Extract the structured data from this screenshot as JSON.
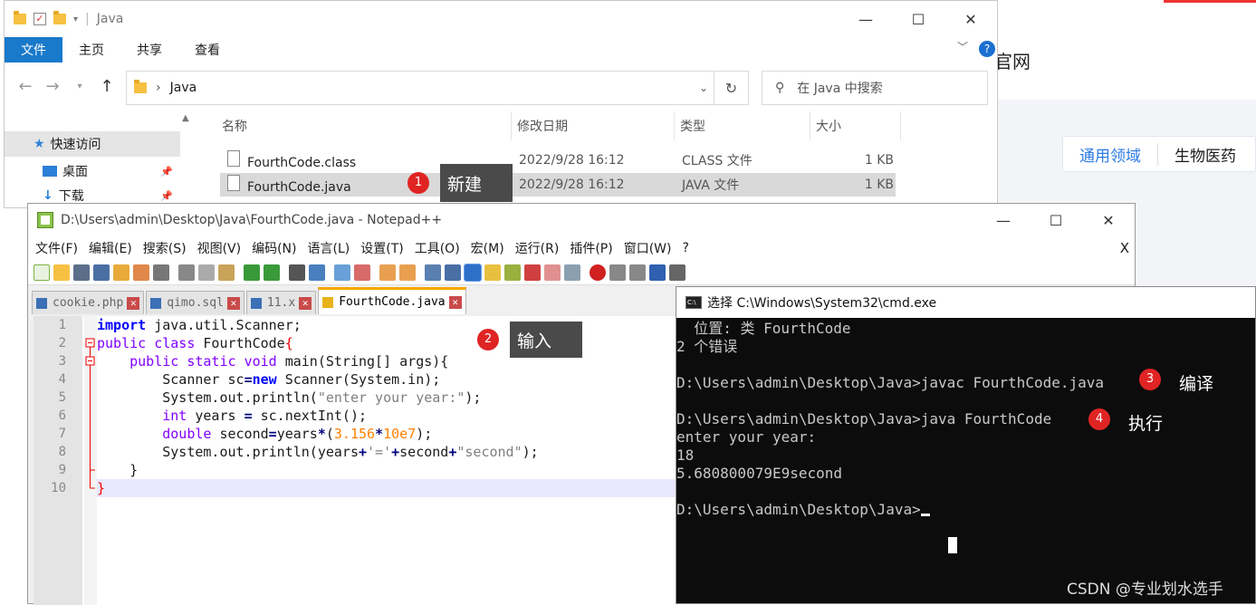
{
  "background_page": {
    "brand_fragment": "官网",
    "tabs": [
      "通用领域",
      "生物医药"
    ]
  },
  "explorer": {
    "title": "Java",
    "ribbon": [
      "文件",
      "主页",
      "共享",
      "查看"
    ],
    "address": {
      "path": "Java"
    },
    "search_placeholder": "在 Java 中搜索",
    "nav": {
      "quick_access": "快速访问",
      "desktop": "桌面",
      "downloads": "下载"
    },
    "columns": {
      "name": "名称",
      "modified": "修改日期",
      "type": "类型",
      "size": "大小"
    },
    "files": [
      {
        "name": "FourthCode.class",
        "modified": "2022/9/28 16:12",
        "type": "CLASS 文件",
        "size": "1 KB"
      },
      {
        "name": "FourthCode.java",
        "modified": "2022/9/28 16:12",
        "type": "JAVA 文件",
        "size": "1 KB"
      }
    ]
  },
  "annotations": [
    {
      "num": "1",
      "text": "新建"
    },
    {
      "num": "2",
      "text": "输入"
    },
    {
      "num": "3",
      "text": "编译"
    },
    {
      "num": "4",
      "text": "执行"
    }
  ],
  "notepad": {
    "title": "D:\\Users\\admin\\Desktop\\Java\\FourthCode.java - Notepad++",
    "menu": [
      "文件(F)",
      "编辑(E)",
      "搜索(S)",
      "视图(V)",
      "编码(N)",
      "语言(L)",
      "设置(T)",
      "工具(O)",
      "宏(M)",
      "运行(R)",
      "插件(P)",
      "窗口(W)",
      "?"
    ],
    "menu_close": "X",
    "tabs": [
      "cookie.php",
      "qimo.sql",
      "11.x",
      "FourthCode.java"
    ],
    "line_numbers": [
      "1",
      "2",
      "3",
      "4",
      "5",
      "6",
      "7",
      "8",
      "9",
      "10"
    ]
  },
  "cmd": {
    "title": "选择 C:\\Windows\\System32\\cmd.exe",
    "lines": [
      "  位置: 类 FourthCode",
      "2 个错误",
      "",
      "D:\\Users\\admin\\Desktop\\Java>javac FourthCode.java",
      "",
      "D:\\Users\\admin\\Desktop\\Java>java FourthCode",
      "enter your year:",
      "18",
      "5.680800079E9second",
      "",
      "D:\\Users\\admin\\Desktop\\Java>"
    ]
  },
  "watermark": "CSDN @专业划水选手"
}
